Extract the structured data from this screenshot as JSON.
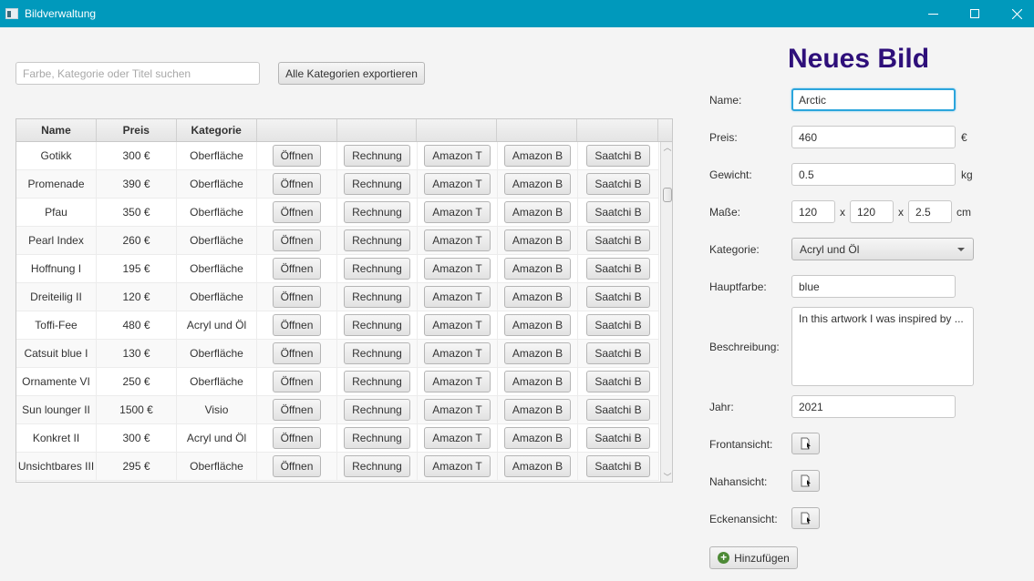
{
  "window": {
    "title": "Bildverwaltung",
    "controls": {
      "minimize": "minimize",
      "maximize": "maximize",
      "close": "close"
    }
  },
  "toolbar": {
    "search_placeholder": "Farbe, Kategorie oder Titel suchen",
    "search_value": "",
    "export_label": "Alle Kategorien exportieren"
  },
  "table": {
    "columns": [
      "Name",
      "Preis",
      "Kategorie",
      "",
      "",
      "",
      "",
      ""
    ],
    "button_labels": {
      "open": "Öffnen",
      "invoice": "Rechnung",
      "amazon_t": "Amazon T",
      "amazon_b": "Amazon B",
      "saatchi_b": "Saatchi B"
    },
    "rows": [
      {
        "name": "Gotikk",
        "price": "300 €",
        "category": "Oberfläche"
      },
      {
        "name": "Promenade",
        "price": "390 €",
        "category": "Oberfläche"
      },
      {
        "name": "Pfau",
        "price": "350 €",
        "category": "Oberfläche"
      },
      {
        "name": "Pearl Index",
        "price": "260 €",
        "category": "Oberfläche"
      },
      {
        "name": "Hoffnung I",
        "price": "195 €",
        "category": "Oberfläche"
      },
      {
        "name": "Dreiteilig II",
        "price": "120 €",
        "category": "Oberfläche"
      },
      {
        "name": "Toffi-Fee",
        "price": "480 €",
        "category": "Acryl und Öl"
      },
      {
        "name": "Catsuit blue I",
        "price": "130 €",
        "category": "Oberfläche"
      },
      {
        "name": "Ornamente VI",
        "price": "250 €",
        "category": "Oberfläche"
      },
      {
        "name": "Sun lounger II",
        "price": "1500 €",
        "category": "Visio"
      },
      {
        "name": "Konkret II",
        "price": "300 €",
        "category": "Acryl und Öl"
      },
      {
        "name": "Unsichtbares III",
        "price": "295 €",
        "category": "Oberfläche"
      }
    ]
  },
  "form": {
    "title": "Neues Bild",
    "title_color": "#2e0f7a",
    "labels": {
      "name": "Name:",
      "price": "Preis:",
      "weight": "Gewicht:",
      "dimensions": "Maße:",
      "category": "Kategorie:",
      "main_color": "Hauptfarbe:",
      "description": "Beschreibung:",
      "year": "Jahr:",
      "front_view": "Frontansicht:",
      "close_view": "Nahansicht:",
      "corner_view": "Eckenansicht:"
    },
    "values": {
      "name": "Arctic",
      "price": "460",
      "weight": "0.5",
      "width": "120",
      "height": "120",
      "depth": "2.5",
      "category": "Acryl und Öl",
      "main_color": "blue",
      "description": "In this artwork I was inspired by ...",
      "year": "2021"
    },
    "units": {
      "price": "€",
      "weight": "kg",
      "times1": "x",
      "times2": "x",
      "dimensions": "cm"
    },
    "add_label": "Hinzufügen"
  }
}
